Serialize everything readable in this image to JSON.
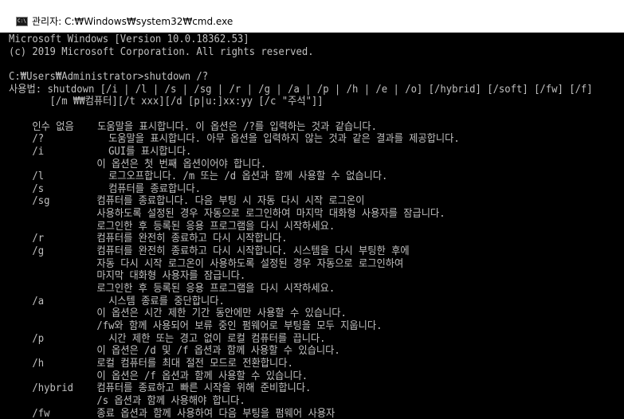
{
  "window": {
    "title": "관리자: C:₩Windows₩system32₩cmd.exe",
    "icon": "cmd-icon",
    "icon_text": "C:\\"
  },
  "console": {
    "lines": [
      {
        "text": "Microsoft Windows [Version 10.0.18362.53]"
      },
      {
        "text": "(c) 2019 Microsoft Corporation. All rights reserved."
      },
      {
        "text": ""
      },
      {
        "text": "C:₩Users₩Administrator>shutdown /?"
      },
      {
        "text": "사용법: shutdown [/i | /l | /s | /sg | /r | /g | /a | /p | /h | /e | /o] [/hybrid] [/soft] [/fw] [/f]"
      },
      {
        "text": "       [/m ₩₩컴퓨터][/t xxx][/d [p|u:]xx:yy [/c \"주석\"]]"
      },
      {
        "text": ""
      },
      {
        "text": "    인수 없음    도움말을 표시합니다. 이 옵션은 /?를 입력하는 것과 같습니다."
      },
      {
        "text": "    /?           도움말을 표시합니다. 아무 옵션을 입력하지 않는 것과 같은 결과를 제공합니다."
      },
      {
        "text": "    /i           GUI를 표시합니다."
      },
      {
        "text": "               이 옵션은 첫 번째 옵션이어야 합니다."
      },
      {
        "text": "    /l           로그오프합니다. /m 또는 /d 옵션과 함께 사용할 수 없습니다."
      },
      {
        "text": "    /s           컴퓨터를 종료합니다."
      },
      {
        "text": "    /sg        컴퓨터를 종료합니다. 다음 부팅 시 자동 다시 시작 로그온이"
      },
      {
        "text": "               사용하도록 설정된 경우 자동으로 로그인하여 마지막 대화형 사용자를 잠급니다."
      },
      {
        "text": "               로그인한 후 등록된 응용 프로그램을 다시 시작하세요."
      },
      {
        "text": "    /r         컴퓨터를 완전히 종료하고 다시 시작합니다."
      },
      {
        "text": "    /g         컴퓨터를 완전히 종료하고 다시 시작합니다. 시스템을 다시 부팅한 후에"
      },
      {
        "text": "               자동 다시 시작 로그온이 사용하도록 설정된 경우 자동으로 로그인하여"
      },
      {
        "text": "               마지막 대화형 사용자를 잠급니다."
      },
      {
        "text": "               로그인한 후 등록된 응용 프로그램을 다시 시작하세요."
      },
      {
        "text": "    /a           시스템 종료를 중단합니다."
      },
      {
        "text": "               이 옵션은 시간 제한 기간 동안에만 사용할 수 있습니다."
      },
      {
        "text": "               /fw와 함께 사용되어 보류 중인 펌웨어로 부팅을 모두 지웁니다."
      },
      {
        "text": "    /p           시간 제한 또는 경고 없이 로컬 컴퓨터를 끕니다."
      },
      {
        "text": "               이 옵션은 /d 및 /f 옵션과 함께 사용할 수 있습니다."
      },
      {
        "text": "    /h         로컬 컴퓨터를 최대 절전 모드로 전환합니다."
      },
      {
        "text": "               이 옵션은 /f 옵션과 함께 사용할 수 있습니다."
      },
      {
        "text": "    /hybrid    컴퓨터를 종료하고 빠른 시작을 위해 준비합니다."
      },
      {
        "text": "               /s 옵션과 함께 사용해야 합니다."
      },
      {
        "text": "    /fw        종료 옵션과 함께 사용하여 다음 부팅을 펌웨어 사용자"
      }
    ]
  },
  "colors": {
    "console_bg": "#000000",
    "console_fg": "#c0c0c0",
    "titlebar_bg": "#ffffff"
  }
}
